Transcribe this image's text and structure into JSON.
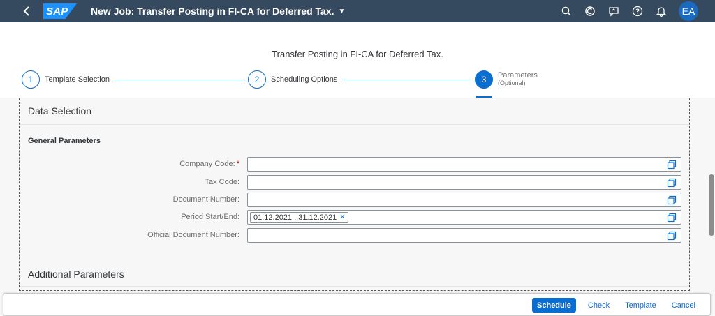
{
  "shell": {
    "title": "New Job: Transfer Posting in FI-CA for Deferred Tax.",
    "logo_text": "SAP",
    "avatar_initials": "EA",
    "icons": [
      "search-icon",
      "copilot-icon",
      "feedback-icon",
      "help-icon",
      "notifications-icon"
    ]
  },
  "header": {
    "page_title": "Transfer Posting in FI-CA for Deferred Tax.",
    "steps": [
      {
        "number": "1",
        "label": "Template Selection",
        "sublabel": ""
      },
      {
        "number": "2",
        "label": "Scheduling Options",
        "sublabel": ""
      },
      {
        "number": "3",
        "label": "Parameters",
        "sublabel": "(Optional)"
      }
    ],
    "active_step": 3
  },
  "content": {
    "section_title": "Data Selection",
    "group_title": "General Parameters",
    "fields": [
      {
        "label": "Company Code:",
        "required": "*",
        "value": ""
      },
      {
        "label": "Tax Code:",
        "value": ""
      },
      {
        "label": "Document Number:",
        "value": ""
      },
      {
        "label": "Period Start/End:",
        "value": "",
        "token": "01.12.2021...31.12.2021"
      },
      {
        "label": "Official Document Number:",
        "value": ""
      }
    ],
    "section2_title": "Additional Parameters"
  },
  "footer": {
    "schedule": "Schedule",
    "check": "Check",
    "template": "Template",
    "cancel": "Cancel"
  },
  "colors": {
    "shell": "#354a5f",
    "accent": "#0a6ed1",
    "required": "#bb0000"
  }
}
